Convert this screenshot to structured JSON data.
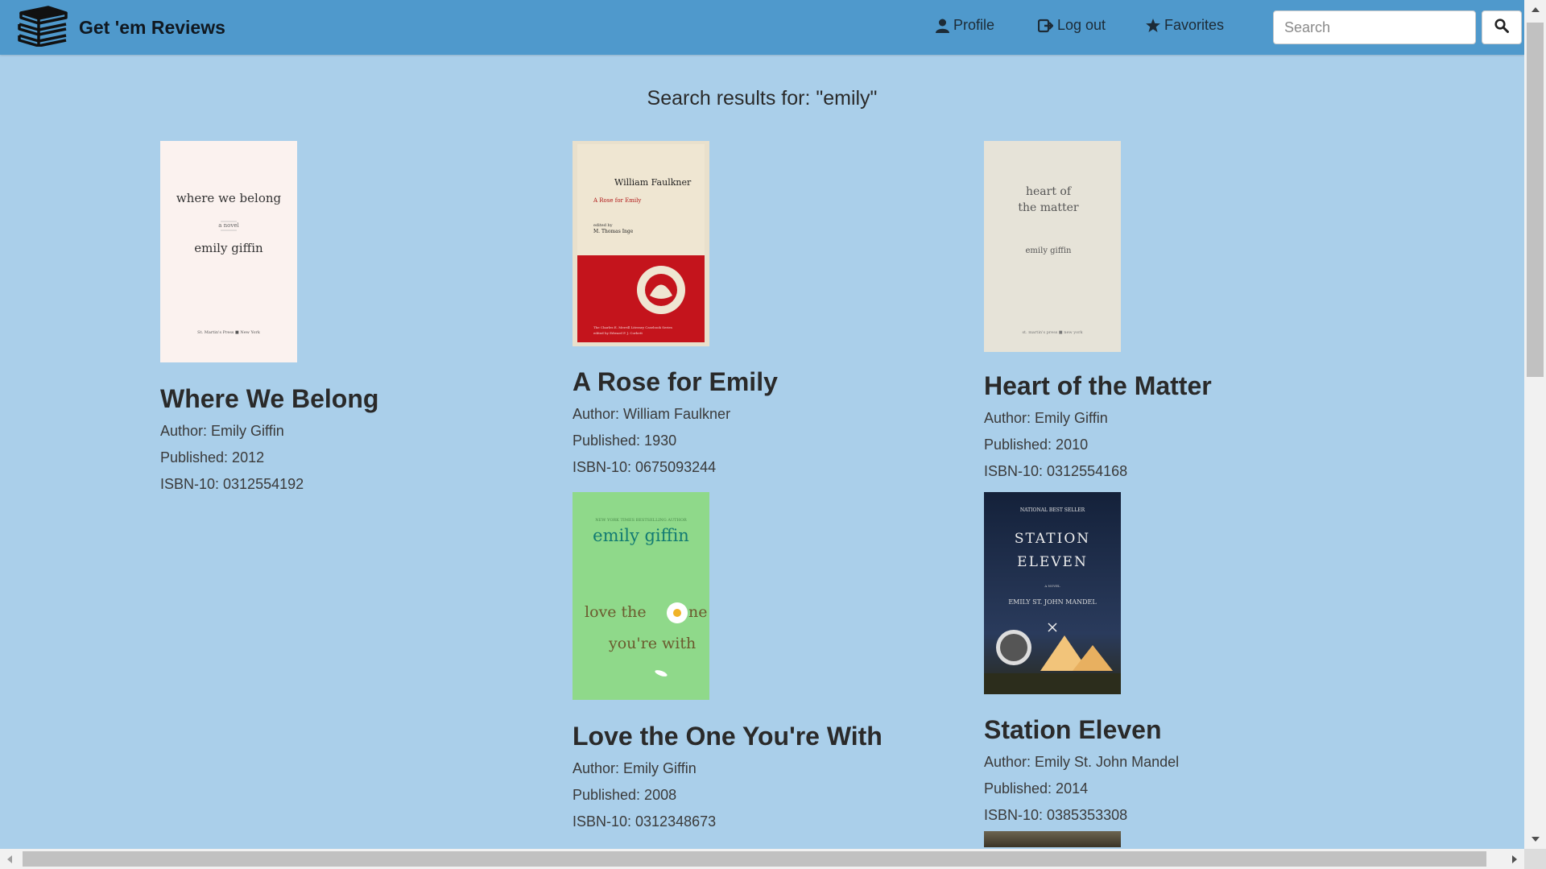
{
  "app": {
    "name": "Get 'em Reviews"
  },
  "nav": {
    "profile": "Profile",
    "logout": "Log out",
    "favorites": "Favorites",
    "search_placeholder": "Search"
  },
  "results_title": "Search results for: \"emily\"",
  "books": [
    {
      "title": "Where We Belong",
      "author": "Author: Emily Giffin",
      "published": "Published: 2012",
      "isbn": "ISBN-10: 0312554192",
      "cover": {
        "line1": "where we belong",
        "line2": "a novel",
        "line3": "emily giffin",
        "footer": "St. Martin's Press  ■  New York"
      }
    },
    {
      "title": "A Rose for Emily",
      "author": "Author: William Faulkner",
      "published": "Published: 1930",
      "isbn": "ISBN-10: 0675093244",
      "cover": {
        "line1": "William Faulkner",
        "line2": "A Rose for Emily",
        "line3": "edited by",
        "line4": "M. Thomas Inge",
        "footer1": "The Charles E. Merrill Literary Casebook Series",
        "footer2": "edited by Edward P. J. Corbett"
      }
    },
    {
      "title": "Heart of the Matter",
      "author": "Author: Emily Giffin",
      "published": "Published: 2010",
      "isbn": "ISBN-10: 0312554168",
      "cover": {
        "line1": "heart of",
        "line2": "the matter",
        "line3": "emily giffin",
        "footer": "st. martin's press  ■  new york"
      }
    },
    {
      "title": "Love the One You're With",
      "author": "Author: Emily Giffin",
      "published": "Published: 2008",
      "isbn": "ISBN-10: 0312348673",
      "cover": {
        "top": "NEW YORK TIMES BESTSELLING AUTHOR",
        "author": "emily giffin",
        "line1": "love the",
        "line1b": "ne",
        "line2": "you're with"
      }
    },
    {
      "title": "Station Eleven",
      "author": "Author: Emily St. John Mandel",
      "published": "Published: 2014",
      "isbn": "ISBN-10: 0385353308",
      "cover": {
        "top": "NATIONAL BEST SELLER",
        "line1": "STATION",
        "line2": "ELEVEN",
        "line3": "A NOVEL",
        "author": "EMILY ST. JOHN MANDEL"
      }
    }
  ],
  "colors": {
    "navbar": "#4f99cc",
    "page_bg": "#aacfea",
    "rose_red": "#c4141c",
    "love_green": "#8fd98a",
    "station_navy": "#1b2a44"
  }
}
